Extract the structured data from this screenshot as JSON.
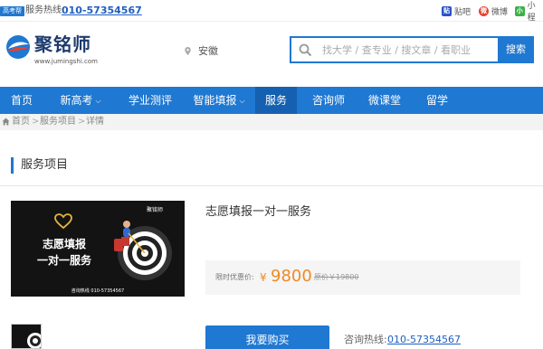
{
  "topbar": {
    "badge": "高考帮",
    "hotline_label": "服务热线:",
    "hotline_number": "010-57354567",
    "social": [
      {
        "icon": "tieba-icon",
        "glyph": "贴",
        "label": "贴吧"
      },
      {
        "icon": "weibo-icon",
        "glyph": "微",
        "label": "微博"
      },
      {
        "icon": "mini-program-icon",
        "glyph": "小",
        "label": "小程"
      }
    ]
  },
  "header": {
    "logo_name": "聚铭师",
    "logo_url": "www.jumingshi.com",
    "location": "安徽",
    "search_placeholder": "找大学 / 查专业 / 搜文章 / 看职业",
    "search_button": "搜索"
  },
  "nav": {
    "items": [
      {
        "label": "首页"
      },
      {
        "label": "新高考",
        "dropdown": true
      },
      {
        "label": "学业测评"
      },
      {
        "label": "智能填报",
        "dropdown": true
      },
      {
        "label": "服务",
        "active": true
      },
      {
        "label": "咨询师"
      },
      {
        "label": "微课堂"
      },
      {
        "label": "留学"
      }
    ]
  },
  "breadcrumb": {
    "items": [
      "首页",
      "服务项目",
      "详情"
    ],
    "separator": ">"
  },
  "section": {
    "title": "服务项目"
  },
  "product": {
    "image_line1": "志愿填报",
    "image_line2": "一对一服务",
    "image_brand": "聚铭师",
    "image_footer": "咨询热线 010-57354567",
    "title": "志愿填报一对一服务",
    "price_label": "限时优惠价:",
    "currency": "¥",
    "price": "9800",
    "original_price": "原价￥19800",
    "buy_button": "我要购买",
    "consult_label": "咨询热线:",
    "consult_number": "010-57354567"
  },
  "colors": {
    "brand_blue": "#1f78d1",
    "nav_active": "#1560b0",
    "price_orange": "#f08a24",
    "image_bg": "#131313",
    "heart_gold": "#e5b43a"
  }
}
